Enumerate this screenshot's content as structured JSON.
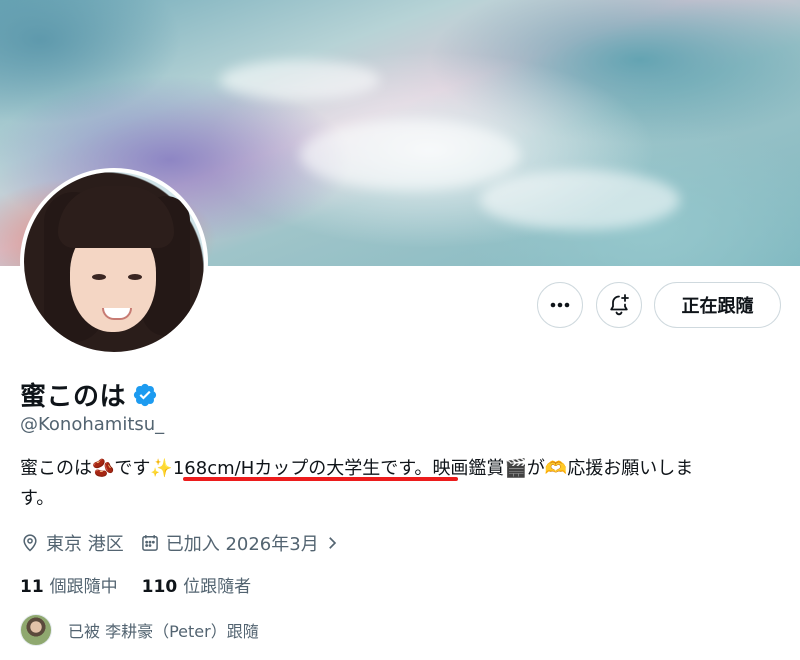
{
  "profile": {
    "name": "蜜このは",
    "handle": "@Konohamitsu_",
    "bio_part1": "蜜このは",
    "bio_emoji1": "🫘",
    "bio_part2": "です",
    "bio_emoji2": "✨",
    "bio_highlight": "168cm/Hカップの大学生です。",
    "bio_part3": "映画鑑賞",
    "bio_emoji3": "🎬",
    "bio_part4": "が",
    "bio_emoji4": "🫶",
    "bio_part5": "応援お願いしま",
    "bio_part6": "す。",
    "location": "東京 港区",
    "joined": "已加入 2026年3月",
    "following_count": "11",
    "following_label": "個跟隨中",
    "followers_count": "110",
    "followers_label": "位跟隨者",
    "followed_by": "已被 李耕豪（Peter）跟隨"
  },
  "actions": {
    "more_label": "•••",
    "follow_label": "正在跟隨"
  },
  "colors": {
    "verified": "#1d9bf0",
    "underline": "#ec1c1c",
    "secondary_text": "#536471"
  }
}
